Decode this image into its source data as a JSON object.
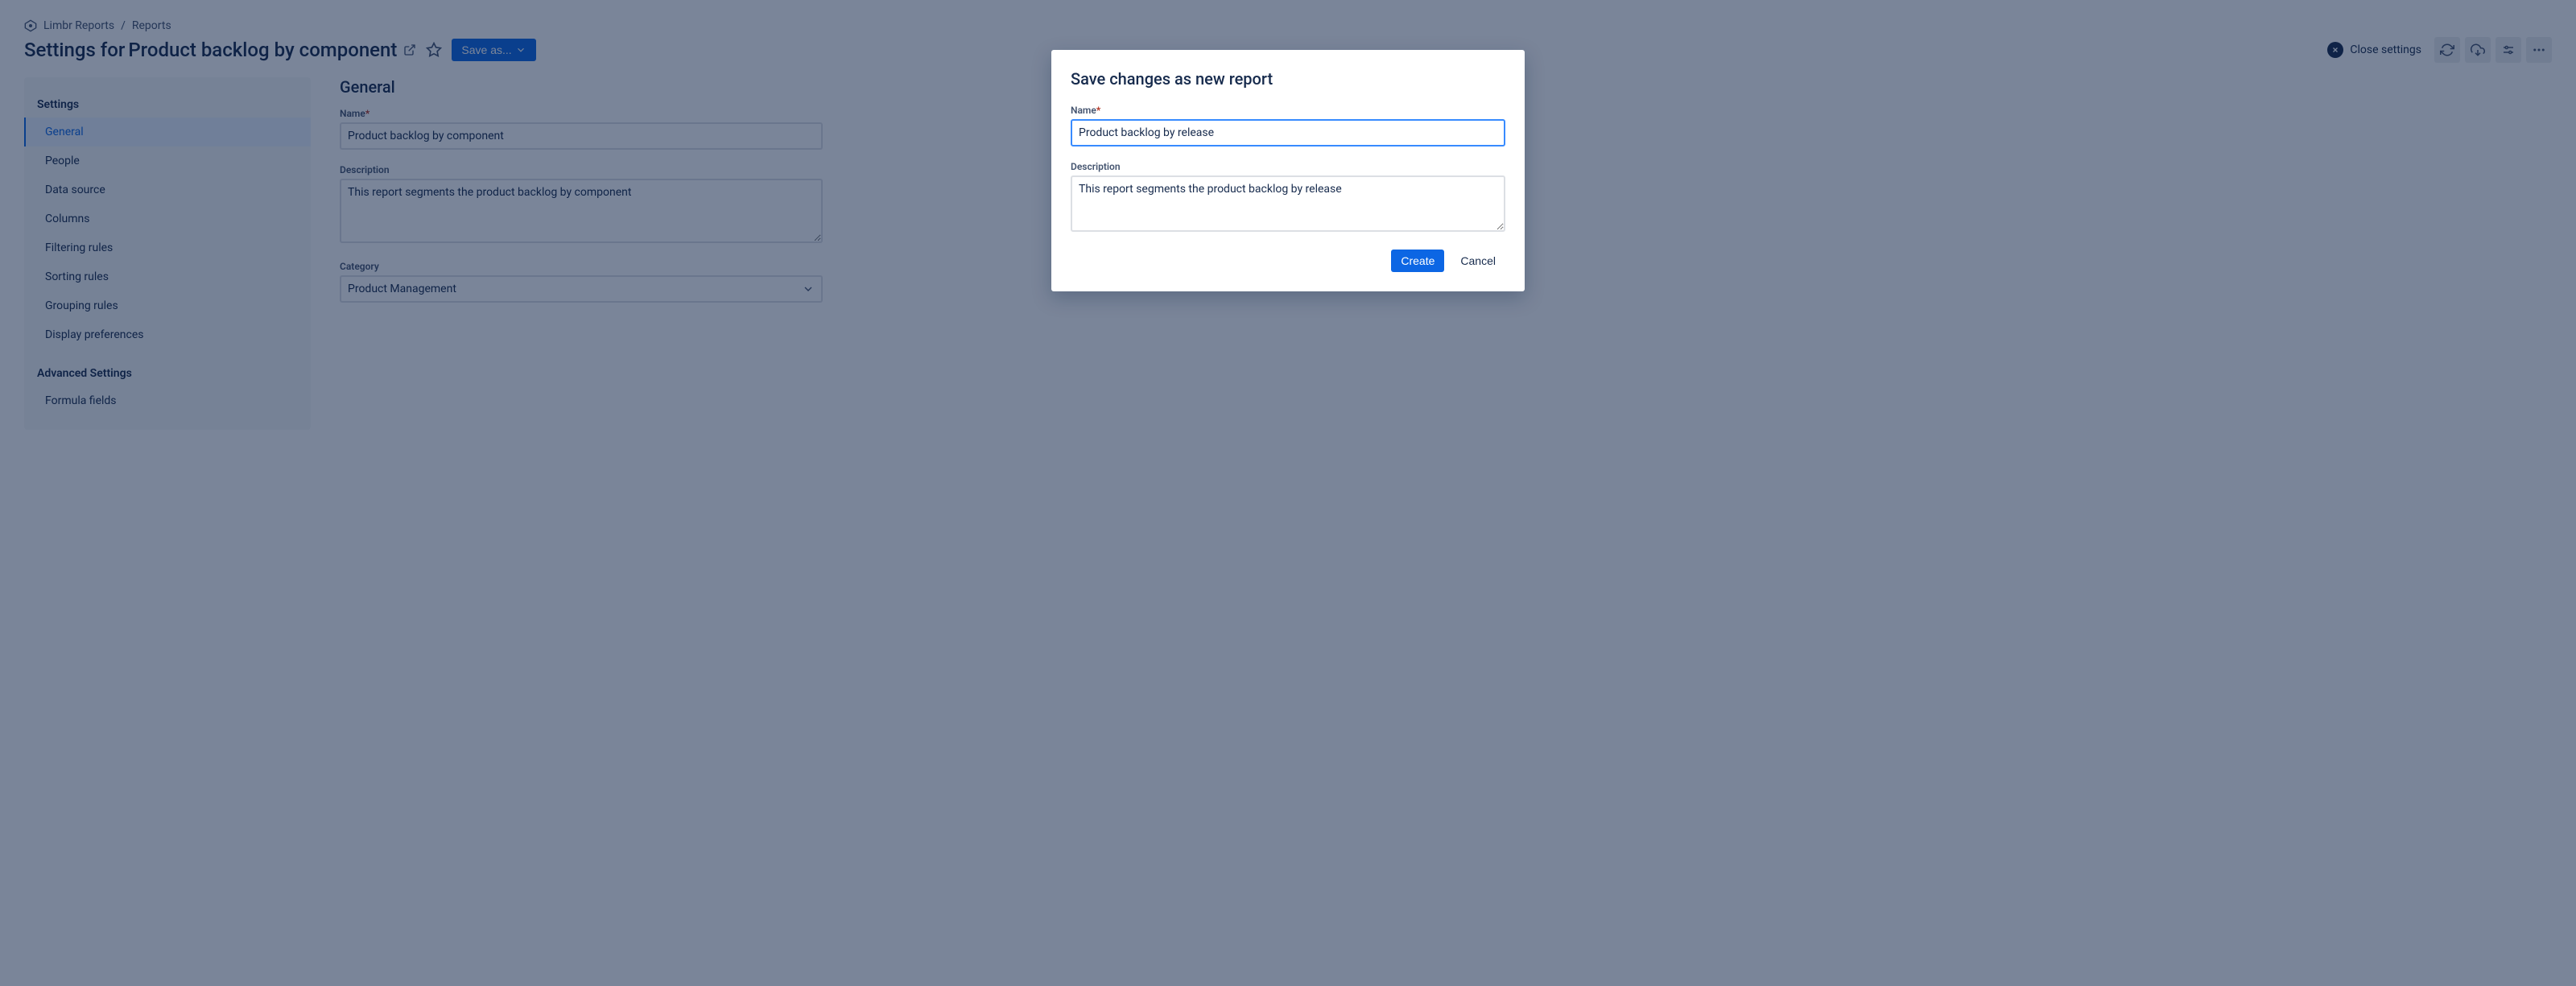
{
  "breadcrumb": {
    "app": "Limbr Reports",
    "section": "Reports"
  },
  "header": {
    "title_prefix": "Settings for ",
    "title_subject": "Product backlog by component",
    "save_as_label": "Save as...",
    "close_label": "Close settings"
  },
  "sidebar": {
    "settings_heading": "Settings",
    "items": [
      {
        "label": "General",
        "active": true
      },
      {
        "label": "People"
      },
      {
        "label": "Data source"
      },
      {
        "label": "Columns"
      },
      {
        "label": "Filtering rules"
      },
      {
        "label": "Sorting rules"
      },
      {
        "label": "Grouping rules"
      },
      {
        "label": "Display preferences"
      }
    ],
    "advanced_heading": "Advanced Settings",
    "advanced_items": [
      {
        "label": "Formula fields"
      }
    ]
  },
  "main": {
    "section_title": "General",
    "name_label": "Name",
    "name_value": "Product backlog by component",
    "description_label": "Description",
    "description_value": "This report segments the product backlog by component",
    "category_label": "Category",
    "category_value": "Product Management"
  },
  "modal": {
    "title": "Save changes as new report",
    "name_label": "Name",
    "name_value": "Product backlog by release",
    "description_label": "Description",
    "description_value": "This report segments the product backlog by release",
    "create_label": "Create",
    "cancel_label": "Cancel"
  }
}
